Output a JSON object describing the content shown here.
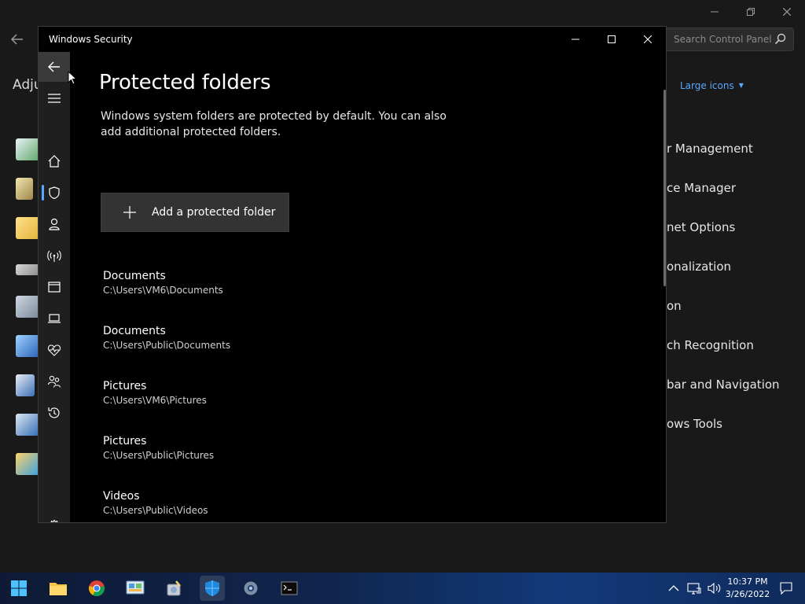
{
  "background_window": {
    "search_placeholder": "Search Control Panel",
    "heading_partial": "Adju",
    "view_by": "Large icons",
    "items": [
      "r Management",
      "ce Manager",
      "net Options",
      "onalization",
      "on",
      "ch Recognition",
      "bar and Navigation",
      "ows Tools"
    ]
  },
  "window": {
    "title": "Windows Security"
  },
  "nav": {
    "items": [
      {
        "name": "back",
        "icon": "back-arrow-icon"
      },
      {
        "name": "menu",
        "icon": "hamburger-icon"
      },
      {
        "name": "home",
        "icon": "home-icon"
      },
      {
        "name": "virus-threat-protection",
        "icon": "shield-icon"
      },
      {
        "name": "account-protection",
        "icon": "person-icon"
      },
      {
        "name": "firewall-network",
        "icon": "antenna-icon"
      },
      {
        "name": "app-browser-control",
        "icon": "browser-window-icon"
      },
      {
        "name": "device-security",
        "icon": "laptop-icon"
      },
      {
        "name": "device-performance",
        "icon": "heart-pulse-icon"
      },
      {
        "name": "family-options",
        "icon": "family-icon"
      },
      {
        "name": "protection-history",
        "icon": "history-icon"
      },
      {
        "name": "settings",
        "icon": "gear-icon"
      }
    ]
  },
  "page": {
    "title": "Protected folders",
    "description": "Windows system folders are protected by default. You can also add additional protected folders.",
    "add_button_label": "Add a protected folder",
    "folders": [
      {
        "name": "Documents",
        "path": "C:\\Users\\VM6\\Documents"
      },
      {
        "name": "Documents",
        "path": "C:\\Users\\Public\\Documents"
      },
      {
        "name": "Pictures",
        "path": "C:\\Users\\VM6\\Pictures"
      },
      {
        "name": "Pictures",
        "path": "C:\\Users\\Public\\Pictures"
      },
      {
        "name": "Videos",
        "path": "C:\\Users\\Public\\Videos"
      }
    ]
  },
  "taskbar": {
    "apps": [
      "start-icon",
      "file-explorer-icon",
      "chrome-icon",
      "control-panel-icon",
      "cleanup-icon",
      "windows-security-icon",
      "settings-icon",
      "terminal-icon"
    ],
    "time": "10:37 PM",
    "date": "3/26/2022"
  },
  "colors": {
    "accent": "#5aa7ff",
    "window_bg": "#000000",
    "nav_bg": "#1f1f1f",
    "button_bg": "#333333"
  }
}
